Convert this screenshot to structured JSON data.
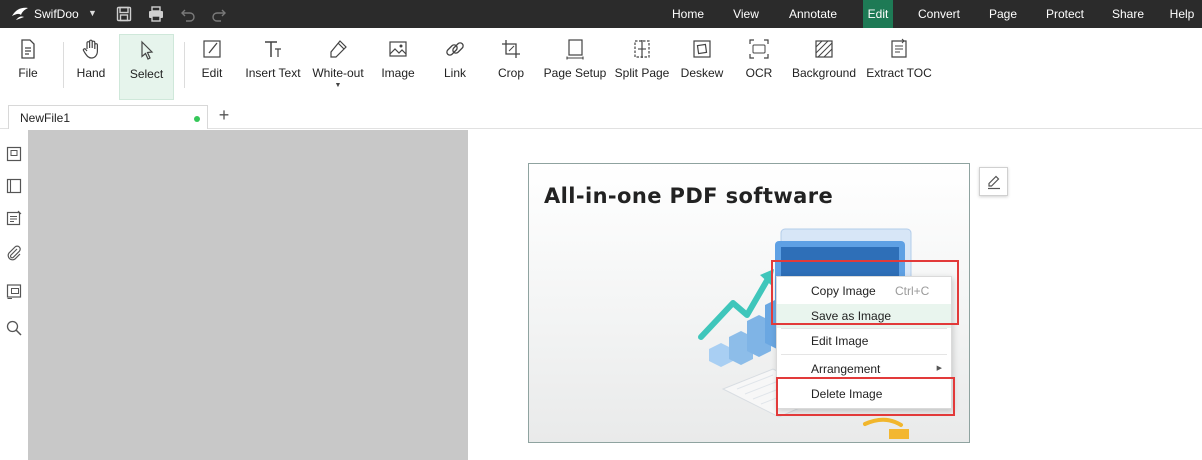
{
  "app": {
    "name": "SwifDoo"
  },
  "menu": [
    {
      "label": "Home",
      "active": false
    },
    {
      "label": "View",
      "active": false
    },
    {
      "label": "Annotate",
      "active": false
    },
    {
      "label": "Edit",
      "active": true
    },
    {
      "label": "Convert",
      "active": false
    },
    {
      "label": "Page",
      "active": false
    },
    {
      "label": "Protect",
      "active": false
    },
    {
      "label": "Share",
      "active": false
    },
    {
      "label": "Help",
      "active": false
    }
  ],
  "toolbar": {
    "tools": [
      {
        "label": "File",
        "icon": "file-icon"
      },
      {
        "label": "Hand",
        "icon": "hand-icon"
      },
      {
        "label": "Select",
        "icon": "select-cursor-icon",
        "selected": true
      },
      {
        "label": "Edit",
        "icon": "edit-icon"
      },
      {
        "label": "Insert Text",
        "icon": "insert-text-icon"
      },
      {
        "label": "White-out",
        "icon": "white-out-icon",
        "has_dropdown": true
      },
      {
        "label": "Image",
        "icon": "image-icon"
      },
      {
        "label": "Link",
        "icon": "link-icon"
      },
      {
        "label": "Crop",
        "icon": "crop-icon"
      },
      {
        "label": "Page Setup",
        "icon": "page-setup-icon"
      },
      {
        "label": "Split Page",
        "icon": "split-page-icon"
      },
      {
        "label": "Deskew",
        "icon": "deskew-icon"
      },
      {
        "label": "OCR",
        "icon": "ocr-icon"
      },
      {
        "label": "Background",
        "icon": "background-icon"
      },
      {
        "label": "Extract TOC",
        "icon": "extract-toc-icon"
      }
    ]
  },
  "tabs": {
    "document": "NewFile1",
    "add_label": "+"
  },
  "sidebar": {
    "icons": [
      "thumbnail-icon",
      "bookmark-icon",
      "annotation-list-icon",
      "attachment-icon",
      "form-field-icon",
      "search-icon"
    ]
  },
  "document": {
    "image_headline": "All-in-one PDF software"
  },
  "context_menu": {
    "items": [
      {
        "label": "Copy Image",
        "shortcut": "Ctrl+C"
      },
      {
        "label": "Save as Image",
        "highlighted": true
      },
      {
        "label": "Edit Image"
      },
      {
        "label": "Arrangement",
        "has_submenu": true
      },
      {
        "label": "Delete Image"
      }
    ]
  },
  "colors": {
    "menubar": "#2b2b2b",
    "active_menu": "#1e7a55",
    "selected_tool": "#e6f4ec",
    "annotation_red": "#e23a3a",
    "tab_dot": "#35c759"
  }
}
